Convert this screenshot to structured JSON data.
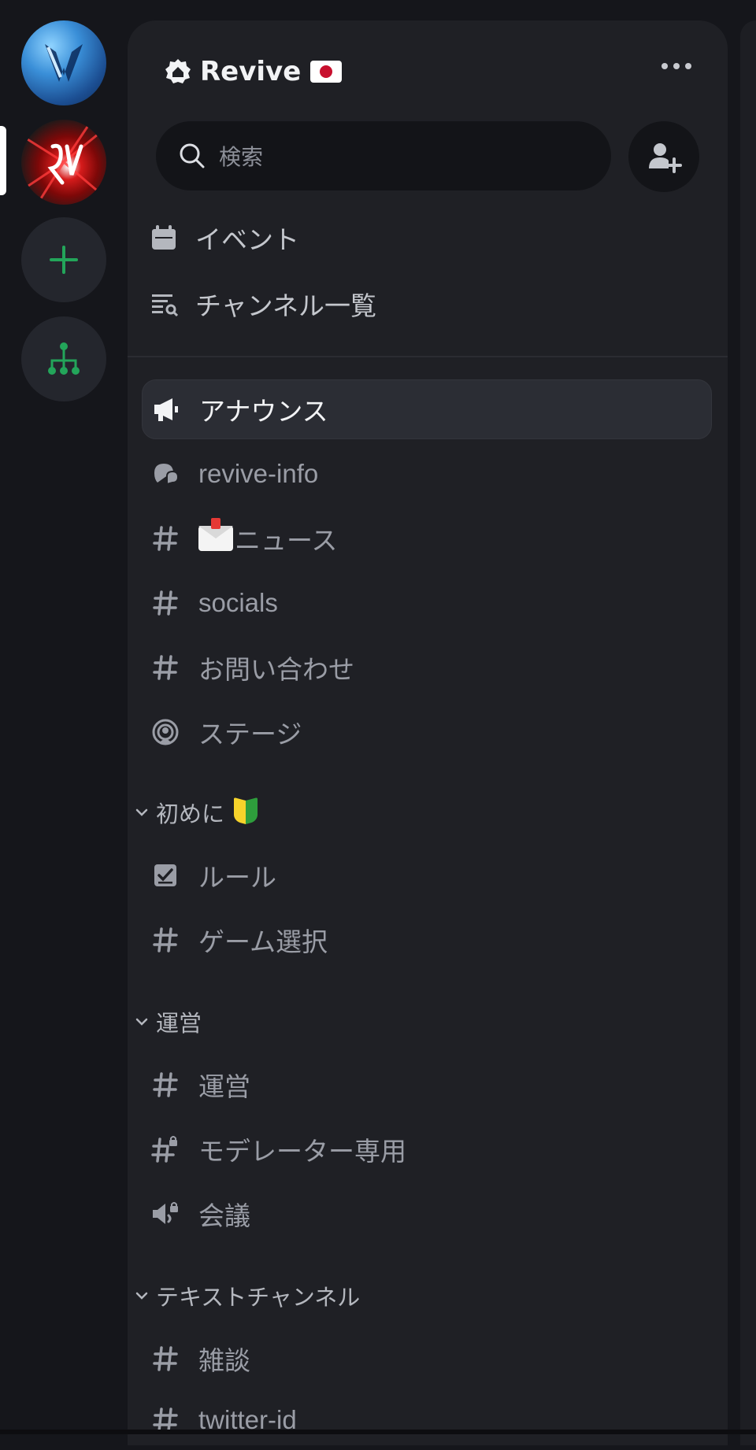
{
  "server_rail": {
    "servers": [
      {
        "name": "server-1-avatar"
      },
      {
        "name": "server-2-avatar"
      }
    ],
    "add_icon": "plus-icon",
    "discover_icon": "hub-icon"
  },
  "server": {
    "name": "Revive",
    "flag": "jp-flag"
  },
  "search": {
    "placeholder": "検索"
  },
  "quick_links": [
    {
      "label": "イベント",
      "icon": "calendar-icon"
    },
    {
      "label": "チャンネル一覧",
      "icon": "channel-browse-icon"
    }
  ],
  "channels": {
    "top": [
      {
        "label": "アナウンス",
        "icon": "announcement-icon",
        "selected": true
      },
      {
        "label": "revive-info",
        "icon": "forum-icon"
      },
      {
        "label": "ニュース",
        "icon": "hash-icon",
        "emoji": "mail-emoji"
      },
      {
        "label": "socials",
        "icon": "hash-icon"
      },
      {
        "label": "お問い合わせ",
        "icon": "hash-icon"
      },
      {
        "label": "ステージ",
        "icon": "stage-icon"
      }
    ],
    "categories": [
      {
        "name": "初めに",
        "emoji": "beginner-mark",
        "items": [
          {
            "label": "ルール",
            "icon": "rules-icon"
          },
          {
            "label": "ゲーム選択",
            "icon": "hash-icon"
          }
        ]
      },
      {
        "name": "運営",
        "items": [
          {
            "label": "運営",
            "icon": "hash-icon"
          },
          {
            "label": "モデレーター専用",
            "icon": "locked-hash-icon"
          },
          {
            "label": "会議",
            "icon": "locked-voice-icon"
          }
        ]
      },
      {
        "name": "テキストチャンネル",
        "items": [
          {
            "label": "雑談",
            "icon": "hash-icon"
          },
          {
            "label": "twitter-id",
            "icon": "hash-icon"
          }
        ]
      }
    ]
  },
  "colors": {
    "background": "#15161b",
    "panel": "#1f2025",
    "accent_green": "#23a55a",
    "selected_bg": "#2b2d34"
  }
}
